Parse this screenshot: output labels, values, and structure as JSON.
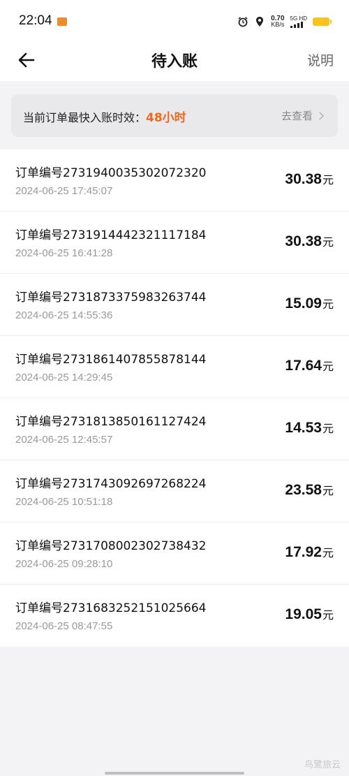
{
  "status_bar": {
    "time": "22:04",
    "speed_value": "0.70",
    "speed_unit": "KB/s",
    "signal": "5G HD",
    "battery_color": "#f8c51c"
  },
  "nav": {
    "title": "待入账",
    "help": "说明"
  },
  "notice": {
    "label": "当前订单最快入账时效：",
    "value": "48小时",
    "link": "去查看",
    "accent": "#f0681c"
  },
  "orders": [
    {
      "number": "订单编号2731940035302072320",
      "time": "2024-06-25 17:45:07",
      "amount": "30.38",
      "unit": "元"
    },
    {
      "number": "订单编号2731914442321117184",
      "time": "2024-06-25 16:41:28",
      "amount": "30.38",
      "unit": "元"
    },
    {
      "number": "订单编号2731873375983263744",
      "time": "2024-06-25 14:55:36",
      "amount": "15.09",
      "unit": "元"
    },
    {
      "number": "订单编号2731861407855878144",
      "time": "2024-06-25 14:29:45",
      "amount": "17.64",
      "unit": "元"
    },
    {
      "number": "订单编号2731813850161127424",
      "time": "2024-06-25 12:45:57",
      "amount": "14.53",
      "unit": "元"
    },
    {
      "number": "订单编号2731743092697268224",
      "time": "2024-06-25 10:51:18",
      "amount": "23.58",
      "unit": "元"
    },
    {
      "number": "订单编号2731708002302738432",
      "time": "2024-06-25 09:28:10",
      "amount": "17.92",
      "unit": "元"
    },
    {
      "number": "订单编号2731683252151025664",
      "time": "2024-06-25 08:47:55",
      "amount": "19.05",
      "unit": "元"
    }
  ],
  "watermark": "鸟鹭旅云"
}
